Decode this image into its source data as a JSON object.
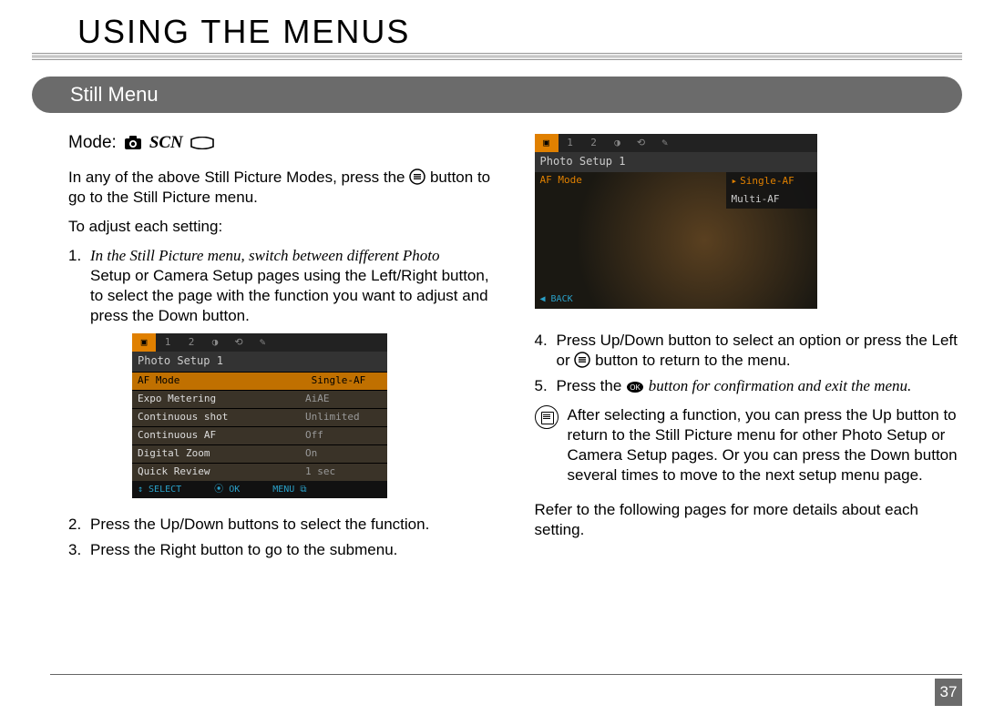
{
  "title": "USING THE MENUS",
  "subheader": "Still Menu",
  "mode_label": "Mode:",
  "mode_scn": "SCN",
  "left": {
    "intro_a": "In any of the above Still Picture Modes, press the",
    "intro_b": "button to go to the Still  Picture menu.",
    "adjust": "To adjust each setting:",
    "step1_italic": "In the Still Picture menu, switch between different Photo",
    "step1_rest": "Setup or Camera Setup pages using the Left/Right button, to select the page with the function you want to adjust and press the Down button.",
    "step2": "Press the Up/Down buttons to select the function.",
    "step3": "Press the Right button to go to the submenu."
  },
  "right": {
    "step4_a": "Press Up/Down button to select an option or press the Left or",
    "step4_b": "button to return to the menu.",
    "step5_a": "Press the",
    "step5_italic": "button for confirmation and exit the menu.",
    "note": "After selecting a function, you can press the Up button to return to the Still Picture menu for other Photo Setup or Camera Setup pages. Or you can press the Down button several times to move to the next setup menu page.",
    "refer": "Refer to the following pages for more details about each setting."
  },
  "lcd1": {
    "title": "Photo Setup 1",
    "rows": [
      {
        "k": "AF Mode",
        "v": "Single-AF",
        "sel": true
      },
      {
        "k": "Expo Metering",
        "v": "AiAE"
      },
      {
        "k": "Continuous shot",
        "v": "Unlimited"
      },
      {
        "k": "Continuous AF",
        "v": "Off"
      },
      {
        "k": "Digital Zoom",
        "v": "On"
      },
      {
        "k": "Quick Review",
        "v": "1 sec"
      }
    ],
    "foot": {
      "a": "↕ SELECT",
      "b": "⦿ OK",
      "c": "MENU ⧉"
    }
  },
  "lcd2": {
    "title": "Photo Setup 1",
    "sel_key": "AF Mode",
    "opts": [
      {
        "t": "Single-AF",
        "sel": true
      },
      {
        "t": "Multi-AF"
      }
    ],
    "back": "◀ BACK"
  },
  "page_number": "37"
}
